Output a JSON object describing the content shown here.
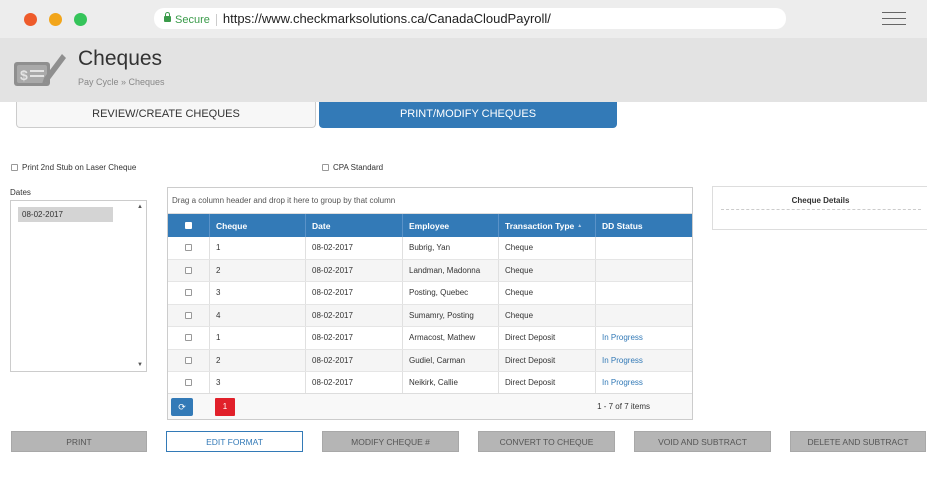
{
  "browser": {
    "secure_label": "Secure",
    "url": "https://www.checkmarksolutions.ca/CanadaCloudPayroll/"
  },
  "header": {
    "title": "Cheques",
    "breadcrumb": "Pay Cycle » Cheques"
  },
  "tabs": [
    {
      "label": "REVIEW/CREATE CHEQUES",
      "active": false
    },
    {
      "label": "PRINT/MODIFY CHEQUES",
      "active": true
    }
  ],
  "options": {
    "print_stub_label": "Print 2nd Stub on Laser Cheque",
    "cpa_standard_label": "CPA Standard"
  },
  "dates": {
    "label": "Dates",
    "items": [
      "08-02-2017"
    ]
  },
  "grid": {
    "group_hint": "Drag a column header and drop it here to group by that column",
    "columns": [
      "Cheque",
      "Date",
      "Employee",
      "Transaction Type",
      "DD Status"
    ],
    "rows": [
      {
        "cheque": "1",
        "date": "08-02-2017",
        "employee": "Bubrig, Yan",
        "type": "Cheque",
        "status": ""
      },
      {
        "cheque": "2",
        "date": "08-02-2017",
        "employee": "Landman, Madonna",
        "type": "Cheque",
        "status": ""
      },
      {
        "cheque": "3",
        "date": "08-02-2017",
        "employee": "Posting, Quebec",
        "type": "Cheque",
        "status": ""
      },
      {
        "cheque": "4",
        "date": "08-02-2017",
        "employee": "Sumamry, Posting",
        "type": "Cheque",
        "status": ""
      },
      {
        "cheque": "1",
        "date": "08-02-2017",
        "employee": "Armacost, Mathew",
        "type": "Direct Deposit",
        "status": "In Progress"
      },
      {
        "cheque": "2",
        "date": "08-02-2017",
        "employee": "Gudiel, Carman",
        "type": "Direct Deposit",
        "status": "In Progress"
      },
      {
        "cheque": "3",
        "date": "08-02-2017",
        "employee": "Neikirk, Callie",
        "type": "Direct Deposit",
        "status": "In Progress"
      }
    ],
    "current_page": "1",
    "items_summary": "1 - 7 of 7 items"
  },
  "details": {
    "title": "Cheque Details"
  },
  "actions": {
    "print": "PRINT",
    "edit_format": "EDIT FORMAT",
    "modify": "MODIFY CHEQUE #",
    "convert": "CONVERT TO CHEQUE",
    "void": "VOID AND SUBTRACT",
    "delete": "DELETE AND SUBTRACT"
  },
  "colors": {
    "primary": "#337ab7",
    "pager_active": "#e1202a",
    "header_bg": "#e3e3e3"
  }
}
